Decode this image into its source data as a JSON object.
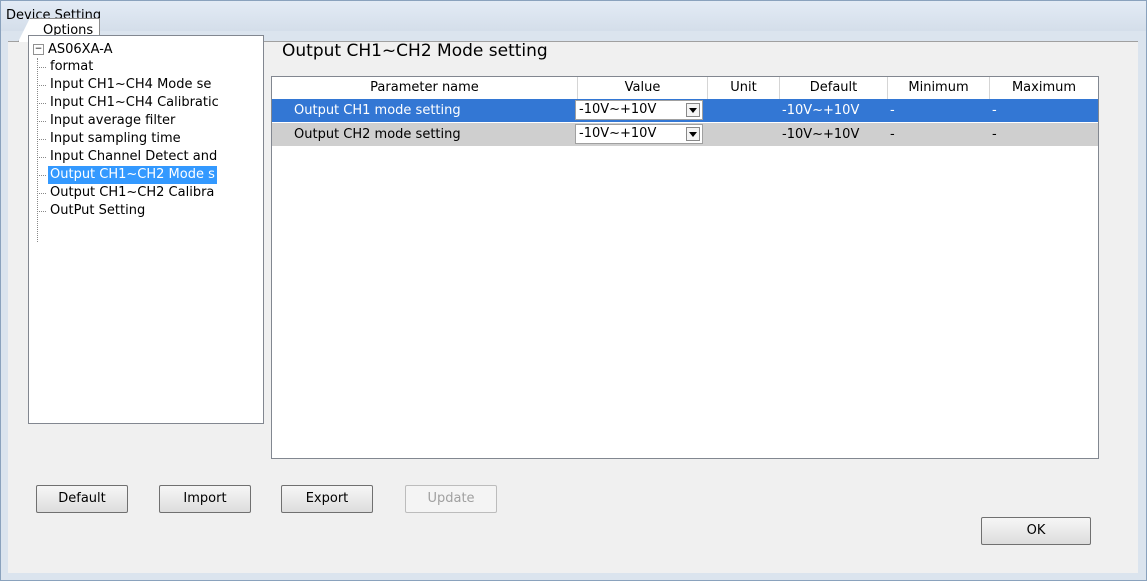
{
  "window": {
    "title": "Device Setting"
  },
  "tabs": [
    {
      "label": "Options"
    }
  ],
  "tree": {
    "root": "AS06XA-A",
    "items": [
      "format",
      "Input CH1~CH4 Mode se",
      "Input CH1~CH4 Calibratic",
      "Input average filter",
      "Input sampling time",
      "Input Channel Detect and",
      "Output CH1~CH2 Mode s",
      "Output CH1~CH2 Calibra",
      "OutPut Setting"
    ],
    "selected_index": 6
  },
  "section": {
    "title": "Output CH1~CH2 Mode setting"
  },
  "table": {
    "columns": [
      "Parameter name",
      "Value",
      "Unit",
      "Default",
      "Minimum",
      "Maximum"
    ],
    "rows": [
      {
        "name": "Output CH1 mode setting",
        "value": "-10V~+10V",
        "unit": "",
        "default": "-10V~+10V",
        "minimum": "-",
        "maximum": "-"
      },
      {
        "name": "Output CH2 mode setting",
        "value": "-10V~+10V",
        "unit": "",
        "default": "-10V~+10V",
        "minimum": "-",
        "maximum": "-"
      }
    ]
  },
  "buttons": {
    "default": "Default",
    "import": "Import",
    "export": "Export",
    "update": "Update",
    "ok": "OK"
  },
  "colors": {
    "selection": "#3377d4",
    "tree_selection": "#3399ff"
  }
}
